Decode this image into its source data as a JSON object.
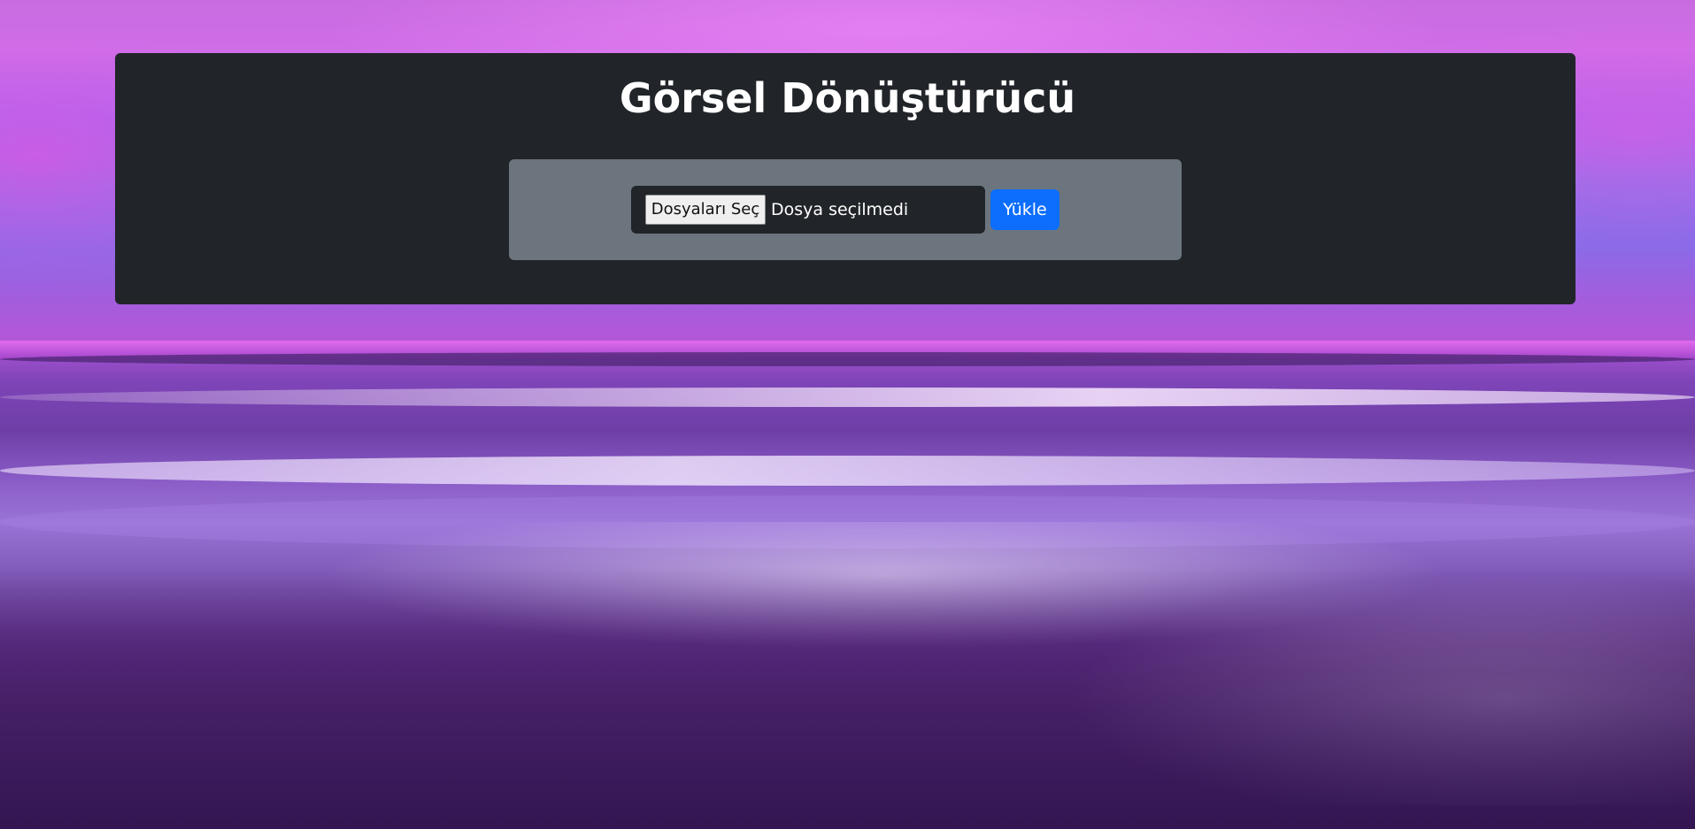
{
  "page": {
    "title": "Görsel Dönüştürücü"
  },
  "upload_form": {
    "file_button_label": "Dosyaları Seç",
    "file_status": "Dosya seçilmedi",
    "submit_label": "Yükle"
  },
  "colors": {
    "panel": "#212529",
    "form_box": "#6c757d",
    "primary_button": "#0d6efd",
    "text": "#ffffff"
  }
}
